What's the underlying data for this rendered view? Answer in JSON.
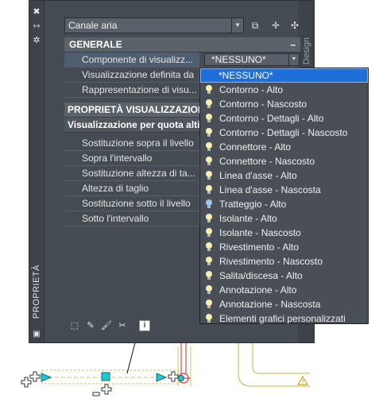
{
  "palette": {
    "panel_bg": "#454b53",
    "selection": "#1e6fd9",
    "cad_red": "#d42a2a",
    "cad_green": "#c9c860",
    "grip_cyan": "#1ec7d2"
  },
  "left_strip": {
    "icons": [
      "close-icon",
      "pin-icon",
      "settings-icon"
    ],
    "vertical_label": "PROPRIETÀ"
  },
  "right_strip": {
    "vertical_label": "Design"
  },
  "combo": {
    "value": "Canale aria"
  },
  "toolbar": {
    "icons": [
      "quick-select-icon",
      "select-objects-icon",
      "toggle-pickadd-icon"
    ]
  },
  "sections": {
    "general": {
      "title": "GENERALE",
      "toggle": "–",
      "rows": [
        {
          "label": "Componente di visualizz...",
          "value": "*NESSUNO*"
        },
        {
          "label": "Visualizzazione definita da",
          "value": ""
        },
        {
          "label": "Rappresentazione di visu...",
          "value": ""
        }
      ]
    },
    "display": {
      "title": "PROPRIETÀ VISUALIZZAZIONE",
      "subtitle": "Visualizzazione per quota altim",
      "rows": [
        "Sostituzione sopra il livello",
        "Sopra l'intervallo",
        "Sostituzione altezza di ta...",
        "Altezza di taglio",
        "Sostituzione sotto il livello",
        "Sotto l'intervallo"
      ]
    }
  },
  "dropdown": {
    "selected": "*NESSUNO*",
    "items": [
      "Contorno - Alto",
      "Contorno - Nascosto",
      "Contorno - Dettagli - Alto",
      "Contorno - Dettagli - Nascosto",
      "Connettore - Alto",
      "Connettore - Nascosto",
      "Linea d'asse - Alto",
      "Linea d'asse - Nascosta",
      "Tratteggio - Alto",
      "Isolante - Alto",
      "Isolante - Nascosto",
      "Rivestimento - Alto",
      "Rivestimento - Nascosto",
      "Salita/discesa - Alto",
      "Annotazione - Alto",
      "Annotazione - Nascosta",
      "Elementi grafici personalizzati"
    ]
  },
  "bottom_icons": [
    "select-objects-icon",
    "edit-style-icon",
    "paint-icon",
    "eraser-icon",
    "info-icon"
  ],
  "info_glyph": "i"
}
